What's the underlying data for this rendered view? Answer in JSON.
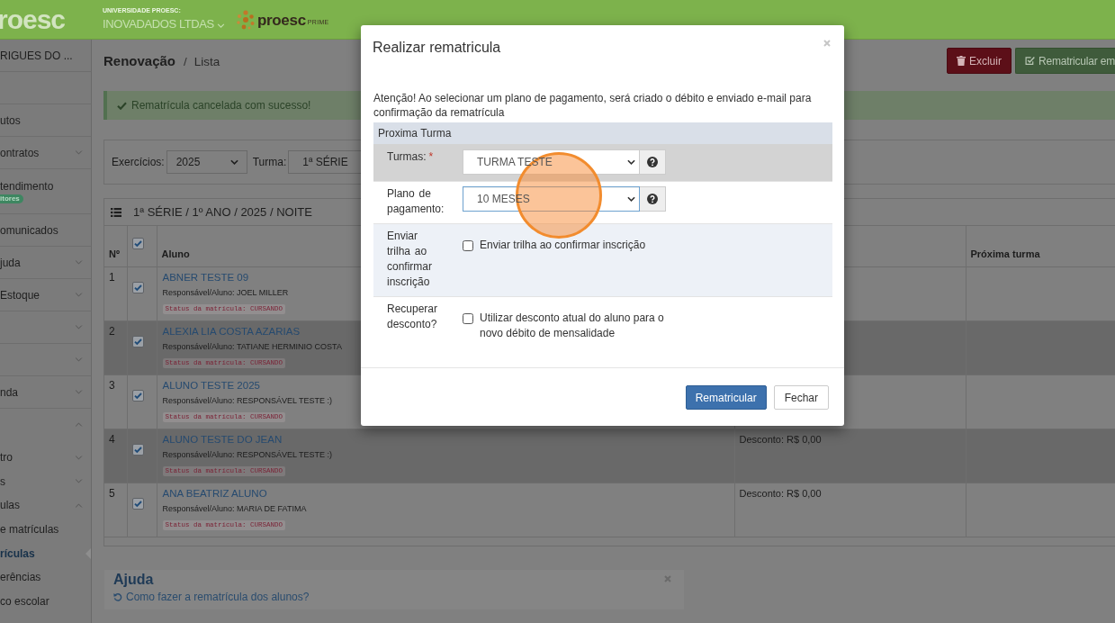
{
  "header": {
    "logo_text": "roesc",
    "organization_caption": "UNIVERSIDADE PROESC:",
    "organization_name": "INOVADADOS LTDAS",
    "brand_name": "proesc",
    "brand_tier": "PRIME"
  },
  "sidebar": {
    "user_name": "RIGUES DO ...",
    "items": [
      {
        "label": "utos"
      },
      {
        "label": "ontratos",
        "expanded": false
      },
      {
        "label": "tendimento",
        "badge": "itores"
      },
      {
        "label": "omunicados"
      },
      {
        "label": "juda",
        "expanded": false
      },
      {
        "label": "Estoque",
        "expanded": false
      },
      {
        "expanded": false
      },
      {
        "expanded": false
      },
      {
        "label": "nda",
        "expanded": false
      },
      {
        "expanded": true,
        "children": [
          {
            "label": "tro",
            "expanded": false
          },
          {
            "label": "s",
            "expanded": false
          },
          {
            "label": "ulas",
            "expanded": true,
            "children": [
              {
                "label": "e matrículas",
                "selected": false
              },
              {
                "label": "rículas",
                "selected": true
              },
              {
                "label": "erências",
                "selected": false
              },
              {
                "label": "co escolar",
                "selected": false
              }
            ]
          }
        ]
      }
    ]
  },
  "page": {
    "title": "Renovação",
    "breadcrumb_separator": "/",
    "breadcrumb": "Lista",
    "actions": [
      {
        "kind": "danger",
        "label": "Excluir"
      },
      {
        "kind": "success",
        "label": "Rematricular em"
      }
    ],
    "alert": {
      "kind": "success",
      "message": "Rematrícula cancelada com sucesso!"
    },
    "filters": [
      {
        "label": "Exercícios:",
        "value": "2025"
      },
      {
        "label": "Turma:",
        "value": "1ª SÉRIE"
      }
    ],
    "table": {
      "title": "1ª SÉRIE / 1º ANO / 2025 / NOITE",
      "columns": [
        {
          "kind": "number",
          "label": "Nº"
        },
        {
          "kind": "checkbox",
          "checked": true
        },
        {
          "kind": "student",
          "label": "Aluno"
        },
        {
          "kind": "text"
        },
        {
          "kind": "text",
          "label": "Próxima turma"
        }
      ],
      "rows": [
        {
          "number": "1",
          "checked": true,
          "student": "ABNER TESTE 09",
          "guardian": "Responsável/Aluno: JOEL MILLER",
          "status": "Status da matrícula: CURSANDO"
        },
        {
          "number": "2",
          "checked": true,
          "student": "ALEXIA LIA COSTA AZARIAS",
          "guardian": "Responsável/Aluno: TATIANE HERMINIO COSTA",
          "status": "Status da matrícula: CURSANDO"
        },
        {
          "number": "3",
          "checked": true,
          "student": "ALUNO TESTE 2025",
          "guardian": "Responsável/Aluno: RESPONSÁVEL TESTE :)",
          "status": "Status da matrícula: CURSANDO"
        },
        {
          "number": "4",
          "checked": true,
          "student": "ALUNO TESTE DO JEAN",
          "guardian": "Responsável/Aluno: RESPONSÁVEL TESTE :)",
          "status": "Status da matrícula: CURSANDO",
          "column_4": "Desconto: R$ 0,00"
        },
        {
          "number": "5",
          "checked": true,
          "student": "ANA BEATRIZ ALUNO",
          "guardian": "Responsável/Aluno: MARIA DE FATIMA",
          "status": "Status da matrícula: CURSANDO",
          "column_4": "Desconto: R$ 0,00"
        }
      ]
    },
    "help": {
      "title": "Ajuda",
      "link": "Como fazer a rematrícula dos alunos?"
    }
  },
  "modal": {
    "title": "Realizar rematricula",
    "notice": "Atenção! Ao selecionar um plano de pagamento, será criado o débito e enviado e-mail para confirmação da rematrícula",
    "section_title": "Proxima Turma",
    "required_symbol": "*",
    "fields": [
      {
        "kind": "select",
        "label": "Turmas:",
        "required": true,
        "value": "TURMA TESTE",
        "focused": false,
        "highlighted": true,
        "clicked": false
      },
      {
        "kind": "select",
        "label": "Plano de pagamento:",
        "required": false,
        "value": "10 MESES",
        "focused": true,
        "highlighted": false,
        "clicked": true
      },
      {
        "kind": "checkbox",
        "label": "Enviar trilha ao confirmar inscrição",
        "required": false,
        "option": "Enviar trilha ao confirmar inscrição",
        "checked": false,
        "highlighted": false,
        "clicked": false
      },
      {
        "kind": "checkbox",
        "label": "Recuperar desconto?",
        "required": false,
        "option": "Utilizar desconto atual do aluno para o novo débito de mensalidade",
        "checked": false,
        "highlighted": false,
        "clicked": false
      }
    ],
    "buttons": [
      {
        "kind": "primary",
        "label": "Rematricular"
      },
      {
        "kind": "default",
        "label": "Fechar"
      }
    ]
  }
}
